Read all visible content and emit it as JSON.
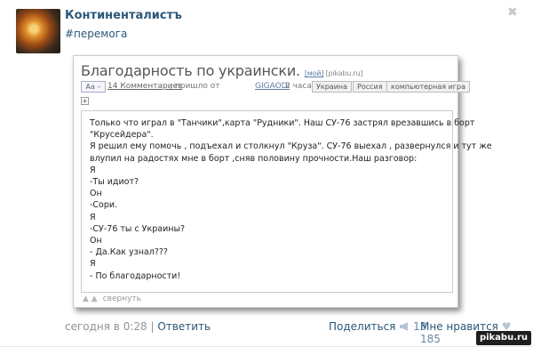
{
  "post": {
    "author": "Континенталистъ",
    "hashtag": "#перемога",
    "close_glyph": "✖",
    "timestamp": "сегодня в 0:28",
    "separator": "|",
    "reply_label": "Ответить",
    "share_label": "Поделиться",
    "share_count": "13",
    "like_label": "Мне нравится",
    "like_count": "185",
    "watermark": "pikabu.ru"
  },
  "card": {
    "title": "Благодарность по украински.",
    "title_mine": "[мой]",
    "title_source": "[pikabu.ru]",
    "aa_label": "Aa –",
    "comments_link": "14 Комментариев",
    "pushed_text": "; пришло от",
    "pushed_user": "GIGAODI",
    "ago": "2 часа назад",
    "tags": [
      "Украина",
      "Россия",
      "компьютерная игра"
    ],
    "plus_glyph": "+",
    "lines": [
      "Только что играл в \"Танчики\",карта \"Рудники\". Наш СУ-76 застрял врезавшись в борт",
      "\"Крусейдера\".",
      "Я решил ему помочь , подъехал и столкнул \"Круза\". СУ-76 выехал , развернулся и тут же",
      "влупил на радостях мне в борт ,сняв половину прочности.Наш разговор:",
      "Я",
      "-Ты идиот?",
      "Он",
      "-Сори.",
      "Я",
      "-СУ-76 ты с Украины?",
      "Он",
      "- Да.Как узнал???",
      "Я",
      "- По благодарности!"
    ],
    "collapse_arrows": "▲ ▲",
    "collapse_label": "свернуть"
  }
}
